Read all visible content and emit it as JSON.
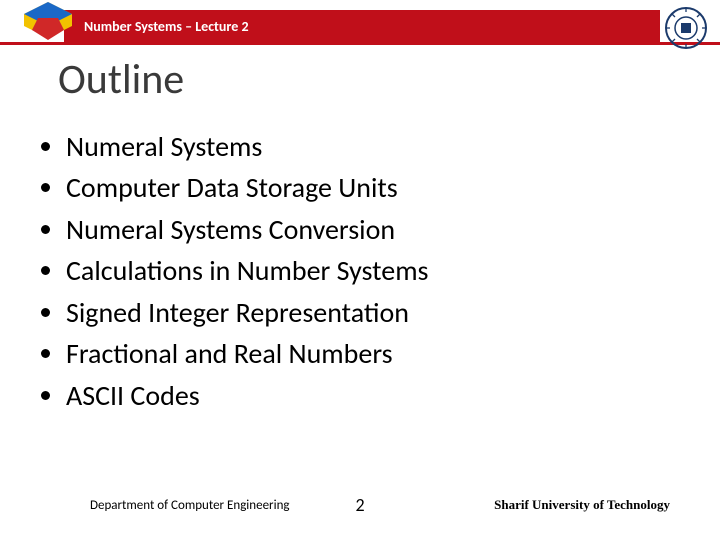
{
  "header": {
    "title": "Number Systems – Lecture 2"
  },
  "title": "Outline",
  "bullets": [
    "Numeral Systems",
    "Computer Data Storage Units",
    "Numeral Systems Conversion",
    "Calculations in Number Systems",
    "Signed Integer Representation",
    "Fractional and Real Numbers",
    "ASCII Codes"
  ],
  "footer": {
    "left": "Department of Computer Engineering",
    "page": "2",
    "right": "Sharif University of Technology"
  }
}
